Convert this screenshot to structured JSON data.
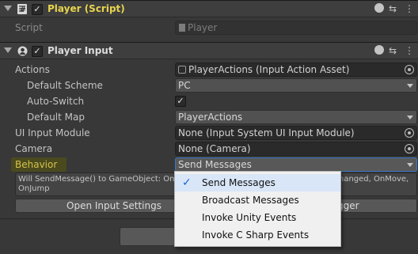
{
  "script_component": {
    "title": "Player (Script)",
    "enabled": true,
    "script_label": "Script",
    "script_value": "Player"
  },
  "player_input": {
    "title": "Player Input",
    "enabled": true,
    "properties": {
      "actions_label": "Actions",
      "actions_value": "PlayerActions (Input Action Asset)",
      "default_scheme_label": "Default Scheme",
      "default_scheme_value": "PC",
      "auto_switch_label": "Auto-Switch",
      "auto_switch_checked": true,
      "default_map_label": "Default Map",
      "default_map_value": "PlayerActions",
      "ui_input_module_label": "UI Input Module",
      "ui_input_module_value": "None (Input System UI Input Module)",
      "camera_label": "Camera",
      "camera_value": "None (Camera)",
      "behavior_label": "Behavior",
      "behavior_value": "Send Messages"
    },
    "help_text_line1": "Will SendMessage() to GameObject: OnDe",
    "help_text_line1_right": "hanged, OnMove,",
    "help_text_line2": "OnJump",
    "open_input_settings_label": "Open Input Settings",
    "debugger_label_fragment": "gger"
  },
  "behavior_menu": {
    "options": [
      "Send Messages",
      "Broadcast Messages",
      "Invoke Unity Events",
      "Invoke C Sharp Events"
    ],
    "selected": "Send Messages"
  },
  "icons": {
    "help": "?",
    "presets": "⇆",
    "more": "⋮",
    "check": "✓"
  },
  "colors": {
    "background": "#383838",
    "header": "#3e3e3e",
    "script_title": "#e8d44d",
    "behavior_highlight": "#4a4a1e",
    "menu_bg": "#f0f0f0",
    "menu_check": "#1b64c8"
  }
}
